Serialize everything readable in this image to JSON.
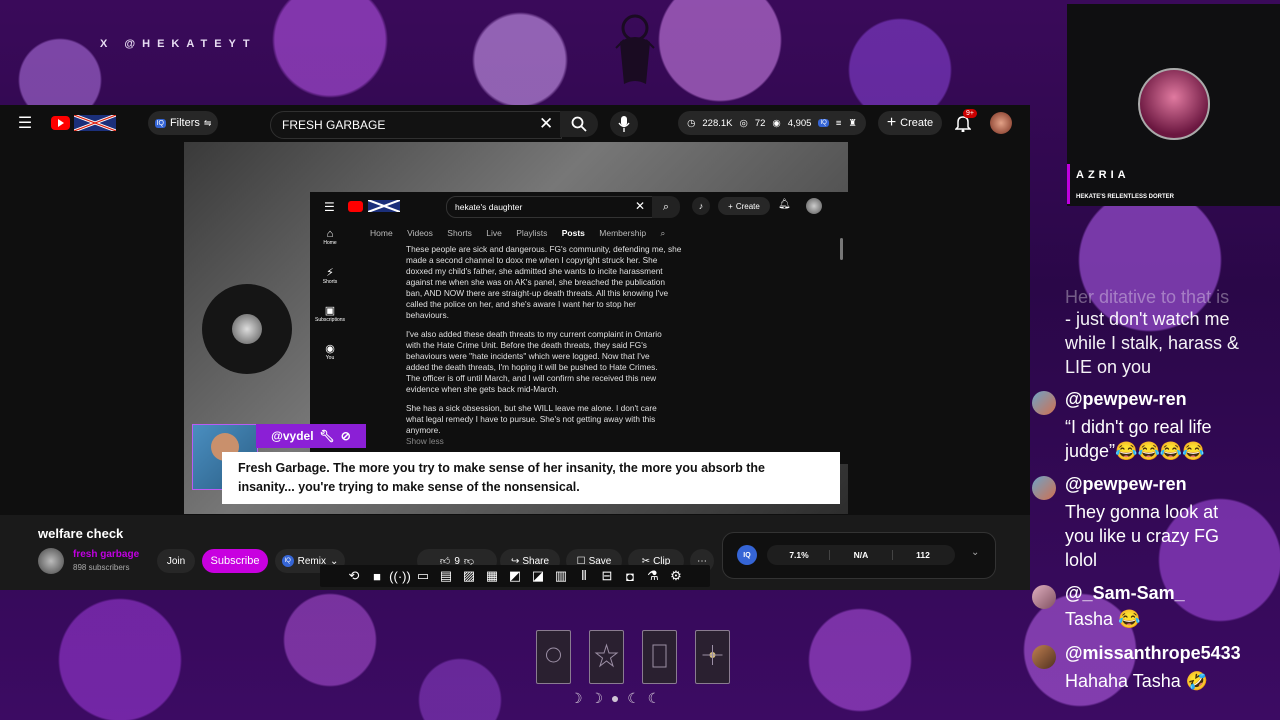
{
  "overlay": {
    "social_handle": "X @HEKATEYT",
    "webcam": {
      "name": "AZRIA",
      "subtitle": "HEKATE'S RELENTLESS DORTER"
    }
  },
  "youtube": {
    "search_query": "FRESH GARBAGE",
    "filters_label": "Filters",
    "iq_badge": "IQ",
    "stats": {
      "views": "228.1K",
      "watching": "72",
      "eyes": "4,905"
    },
    "create_label": "Create",
    "notif_count": "9+",
    "inner_page": {
      "search_query": "hekate's daughter",
      "create_label": "Create",
      "tabs": [
        "Home",
        "Videos",
        "Shorts",
        "Live",
        "Playlists",
        "Posts",
        "Membership"
      ],
      "active_tab": "Posts",
      "sidebar": [
        "Home",
        "Shorts",
        "Subscriptions",
        "You"
      ],
      "post_lines": [
        "These people are sick and dangerous. FG's community, defending me, she",
        "made a second channel to doxx me when I copyright struck her. She",
        "doxxed my child's father, she admitted she wants to incite harassment",
        "against me when she was on AK's panel, she breached the publication",
        "ban, AND NOW there are straight-up death threats. All this knowing I've",
        "called the police on her, and she's aware I want her to stop her",
        "behaviours.",
        "",
        "I've also added these death threats to my current complaint in Ontario",
        "with the Hate Crime Unit. Before the death threats, they said FG's",
        "behaviours were \"hate incidents\" which were logged. Now that I've",
        "added the death threats, I'm hoping it will be pushed to Hate Crimes.",
        "The officer is off until March, and I will confirm she received this new",
        "evidence when she gets back mid-March.",
        "",
        "She has a sick obsession, but she WILL leave me alone. I don't care",
        "what legal remedy I have to pursue. She's not getting away with this",
        "anymore."
      ],
      "show_less": "Show less"
    },
    "chat_overlay": {
      "username": "@vydel",
      "message": "Fresh Garbage. The more you try to make sense of her insanity, the more you absorb the insanity... you're trying to make sense of the nonsensical."
    },
    "video_title": "welfare check",
    "channel": {
      "name": "fresh garbage",
      "subscribers": "898 subscribers"
    },
    "join_label": "Join",
    "subscribe_label": "Subscribe",
    "remix_label": "Remix",
    "likes": "9",
    "share_label": "Share",
    "save_label": "Save",
    "clip_label": "Clip",
    "iq_stats": [
      "7.1%",
      "N/A",
      "112"
    ]
  },
  "chat": {
    "partial_message": [
      "Her ditative to that is",
      "- just don't watch me",
      "while I stalk, harass &",
      "LIE on you"
    ],
    "messages": [
      {
        "user": "@pewpew-ren",
        "lines": [
          "“I didn't go real life",
          "judge”😂😂😂😂"
        ]
      },
      {
        "user": "@pewpew-ren",
        "lines": [
          "They gonna look at",
          "you like u crazy FG",
          "lolol"
        ]
      },
      {
        "user": "@_Sam-Sam_",
        "lines": [
          "Tasha 😂"
        ]
      },
      {
        "user": "@missanthrope5433",
        "lines": [
          "Hahaha Tasha 🤣"
        ]
      }
    ]
  },
  "colors": {
    "youtube_red": "#ff0000",
    "subscribe": "#c800e0",
    "chat_name_bar": "#8b1fd6"
  }
}
